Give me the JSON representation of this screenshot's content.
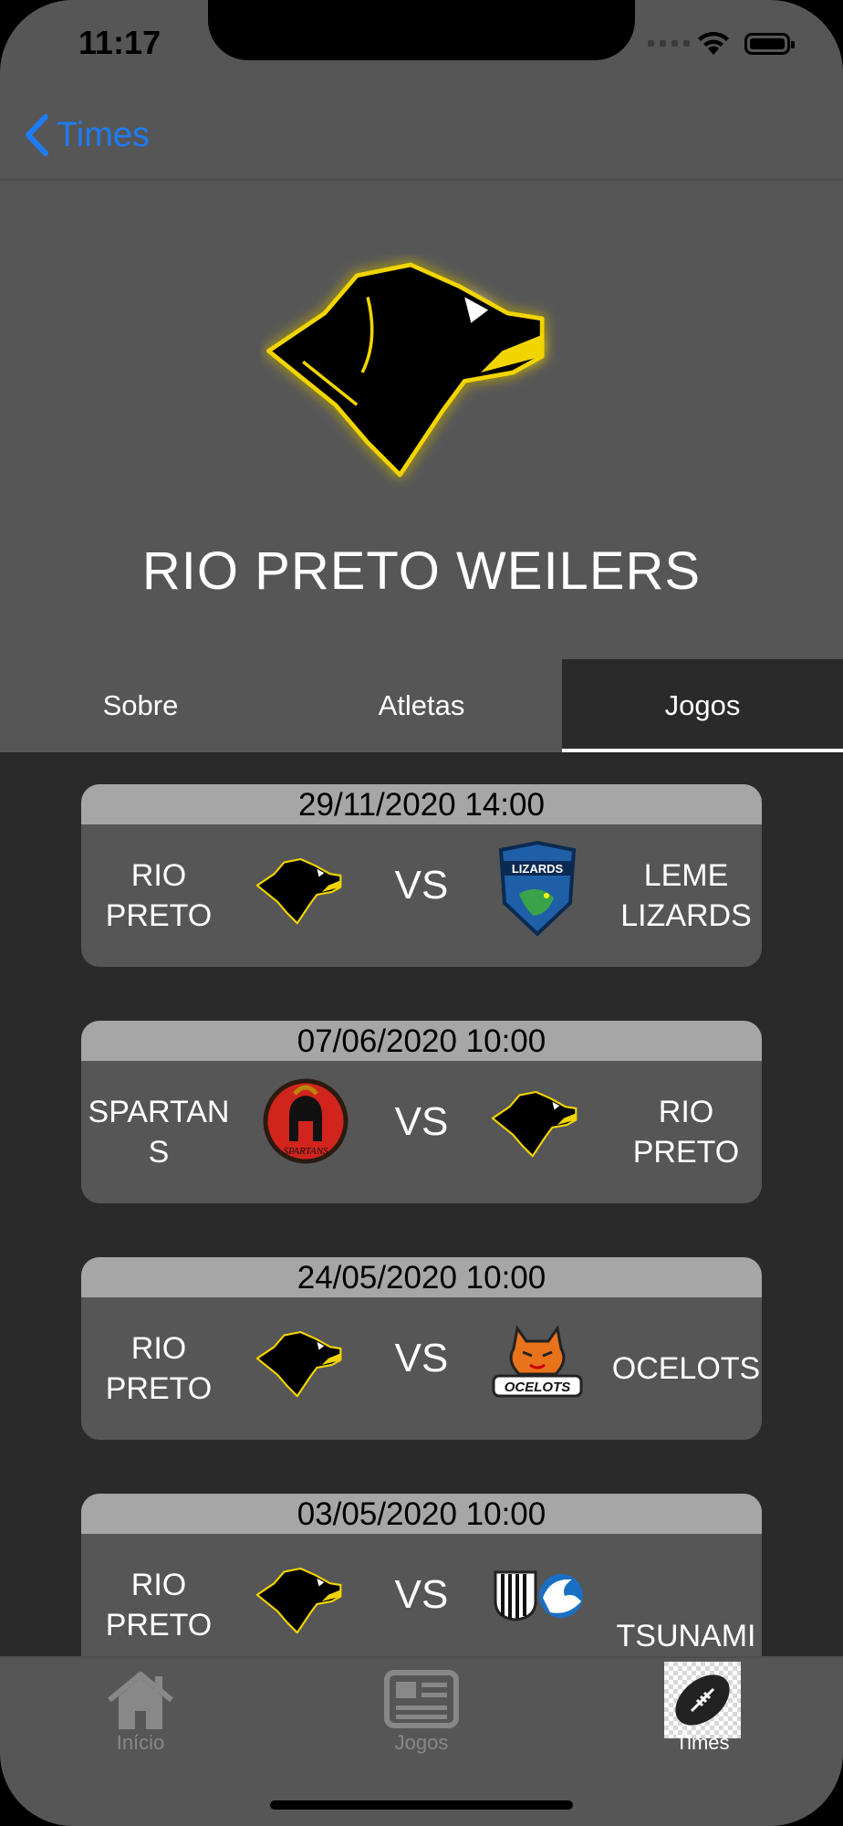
{
  "status_bar": {
    "time": "11:17"
  },
  "nav": {
    "back_label": "Times"
  },
  "team": {
    "name": "RIO PRETO WEILERS"
  },
  "tabs": [
    {
      "label": "Sobre",
      "active": false
    },
    {
      "label": "Atletas",
      "active": false
    },
    {
      "label": "Jogos",
      "active": true
    }
  ],
  "games": [
    {
      "date": "29/11/2020 14:00",
      "home": "RIO PRETO",
      "away": "LEME LIZARDS",
      "vs": "VS"
    },
    {
      "date": "07/06/2020 10:00",
      "home": "SPARTAN S",
      "away": "RIO PRETO",
      "vs": "VS"
    },
    {
      "date": "24/05/2020 10:00",
      "home": "RIO PRETO",
      "away": "OCELOTS",
      "vs": "VS"
    },
    {
      "date": "03/05/2020 10:00",
      "home": "RIO PRETO",
      "away": "TSUNAMI",
      "vs": "VS"
    }
  ],
  "tab_bar": [
    {
      "label": "Início",
      "icon": "home-icon",
      "active": false
    },
    {
      "label": "Jogos",
      "icon": "newspaper-icon",
      "active": false
    },
    {
      "label": "Times",
      "icon": "football-icon",
      "active": true
    }
  ],
  "colors": {
    "background": "#2a2a2a",
    "surface": "#565656",
    "date_bar": "#a6a6a6",
    "accent_blue": "#1e7cf5",
    "weilers_yellow": "#f2d500"
  }
}
